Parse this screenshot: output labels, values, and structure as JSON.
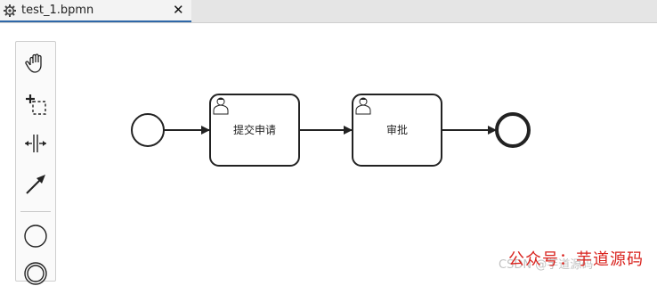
{
  "tab": {
    "title": "test_1.bpmn",
    "close_glyph": "✕",
    "icon": "gear-icon"
  },
  "palette": {
    "tools": [
      {
        "name": "hand-tool",
        "icon": "hand-icon"
      },
      {
        "name": "lasso-tool",
        "icon": "lasso-icon"
      },
      {
        "name": "space-tool",
        "icon": "space-icon"
      },
      {
        "name": "global-connect-tool",
        "icon": "connect-arrow-icon"
      },
      {
        "name": "create-start-event",
        "icon": "start-event-icon"
      },
      {
        "name": "create-intermediate-event",
        "icon": "intermediate-event-icon"
      }
    ]
  },
  "diagram": {
    "start_event": {
      "label": ""
    },
    "tasks": [
      {
        "label": "提交申请",
        "type": "user-task"
      },
      {
        "label": "审批",
        "type": "user-task"
      }
    ],
    "end_event": {
      "label": ""
    }
  },
  "watermark": {
    "main": "公众号：芋道源码",
    "csdn": "CSDN @芋道源码"
  },
  "colors": {
    "stroke": "#222222",
    "watermark": "#d9231e",
    "tab_underline": "#2f68a8"
  }
}
